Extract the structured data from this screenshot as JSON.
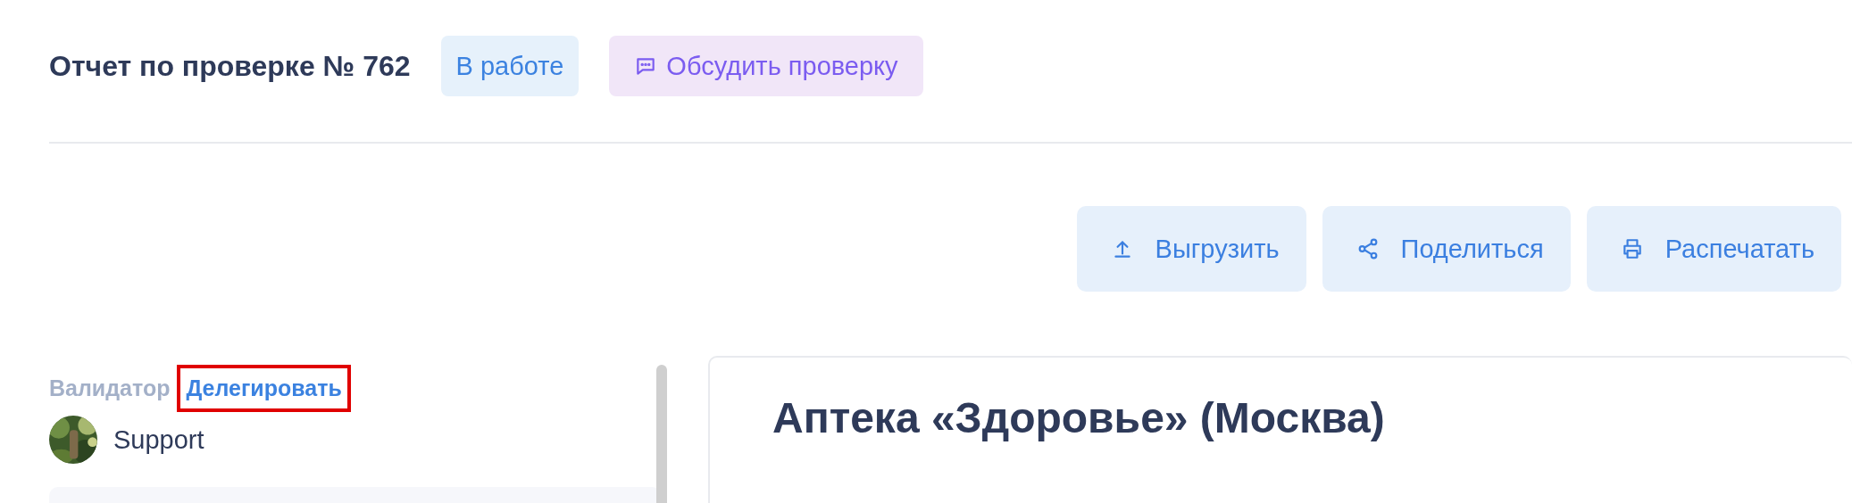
{
  "header": {
    "title": "Отчет по проверке № 762",
    "status": "В работе",
    "discuss_button": "Обсудить проверку"
  },
  "actions": [
    {
      "kind": "export",
      "label": "Выгрузить"
    },
    {
      "kind": "share",
      "label": "Поделиться"
    },
    {
      "kind": "print",
      "label": "Распечатать"
    }
  ],
  "sidebar": {
    "label": "Валидатор",
    "delegate_link": {
      "text": "Делегировать",
      "highlighted": true
    },
    "validator": {
      "name": "Support"
    }
  },
  "card": {
    "title": "Аптека «Здоровье» (Москва)"
  }
}
